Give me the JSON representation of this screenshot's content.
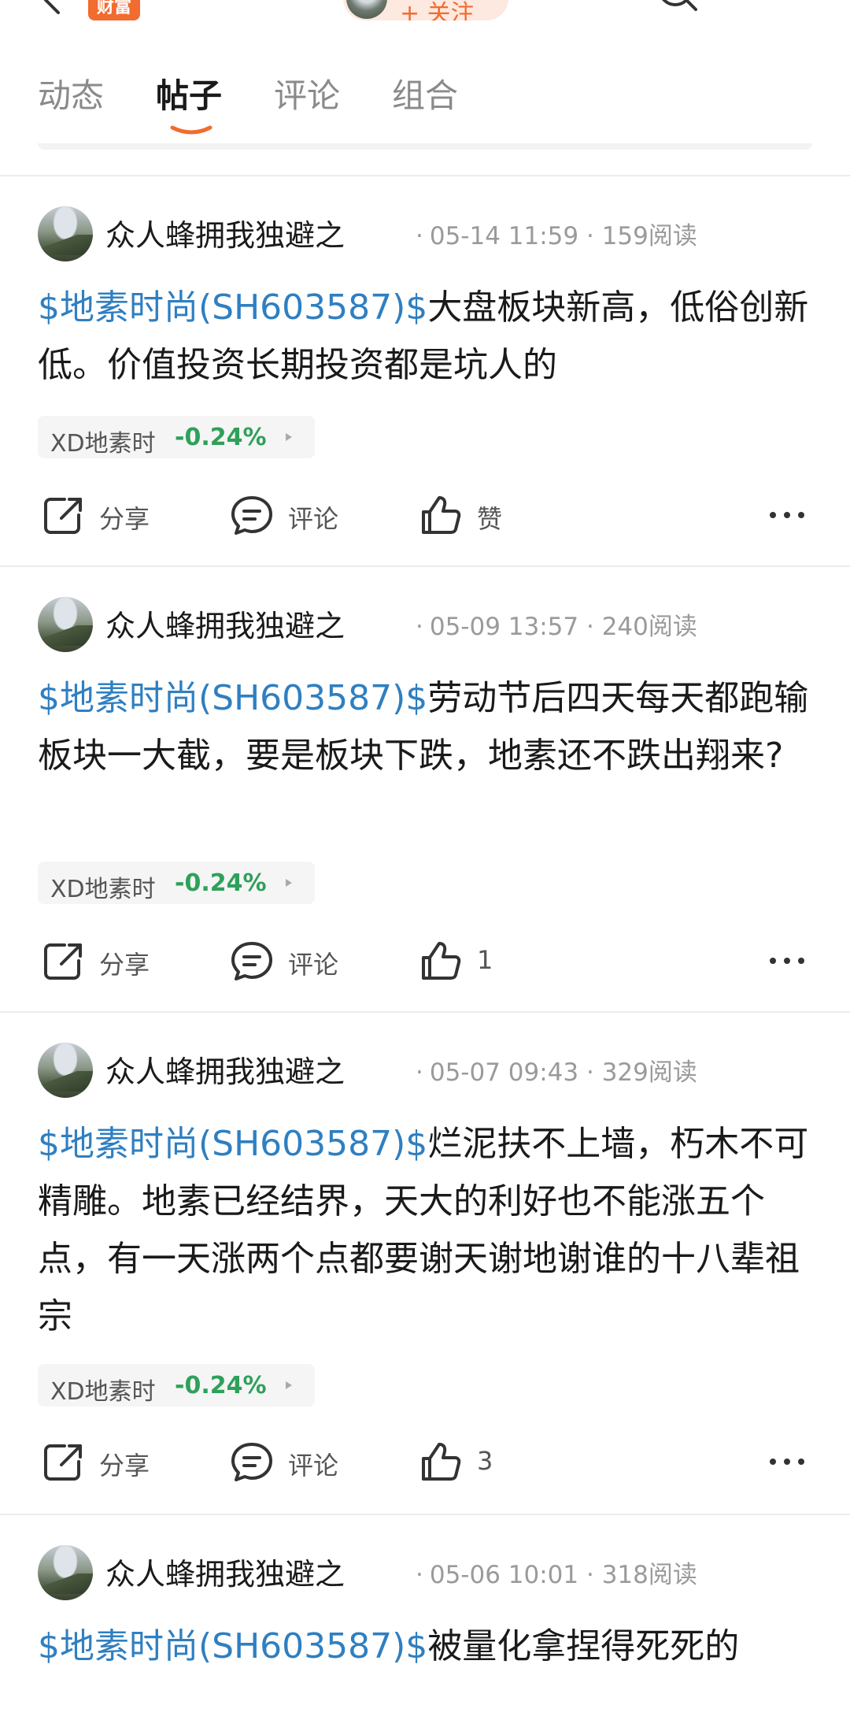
{
  "header": {
    "brand_label": "财富",
    "follow_label": "+ 关注"
  },
  "tabs": [
    {
      "label": "动态",
      "active": false
    },
    {
      "label": "帖子",
      "active": true
    },
    {
      "label": "评论",
      "active": false
    },
    {
      "label": "组合",
      "active": false
    }
  ],
  "colors": {
    "accent": "#f26b2f",
    "link": "#2f7fc1",
    "down_change": "#2fa05a"
  },
  "posts": [
    {
      "author": "众人蜂拥我独避之",
      "date": "05-14 11:59",
      "reads": "159阅读",
      "stock_link": "$地素时尚(SH603587)$",
      "text": "大盘板块新高，低俗创新低。价值投资长期投资都是坑人的",
      "tag_name": "XD地素时",
      "tag_change": "-0.24%",
      "share_label": "分享",
      "comment_label": "评论",
      "like_label": "赞"
    },
    {
      "author": "众人蜂拥我独避之",
      "date": "05-09 13:57",
      "reads": "240阅读",
      "stock_link": "$地素时尚(SH603587)$",
      "text": "劳动节后四天每天都跑输板块一大截，要是板块下跌，地素还不跌出翔来?",
      "tag_name": "XD地素时",
      "tag_change": "-0.24%",
      "share_label": "分享",
      "comment_label": "评论",
      "like_label": "1"
    },
    {
      "author": "众人蜂拥我独避之",
      "date": "05-07 09:43",
      "reads": "329阅读",
      "stock_link": "$地素时尚(SH603587)$",
      "text": "烂泥扶不上墙，朽木不可精雕。地素已经结界，天大的利好也不能涨五个点，有一天涨两个点都要谢天谢地谢谁的十八辈祖宗",
      "tag_name": "XD地素时",
      "tag_change": "-0.24%",
      "share_label": "分享",
      "comment_label": "评论",
      "like_label": "3"
    },
    {
      "author": "众人蜂拥我独避之",
      "date": "05-06 10:01",
      "reads": "318阅读",
      "stock_link": "$地素时尚(SH603587)$",
      "text": "被量化拿捏得死死的"
    }
  ]
}
